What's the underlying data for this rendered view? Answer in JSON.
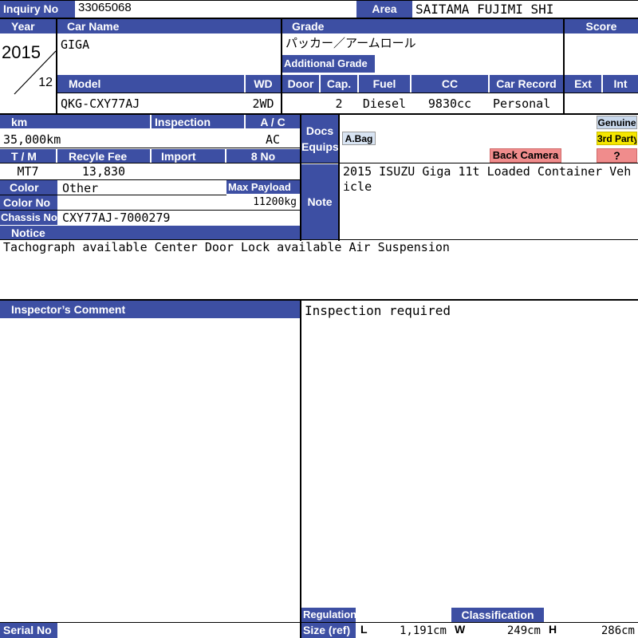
{
  "header": {
    "inquiry_label": "Inquiry No",
    "inquiry_value": "33065068",
    "area_label": "Area",
    "area_value": "SAITAMA FUJIMI SHI"
  },
  "car": {
    "year_label": "Year",
    "year_value": "2015",
    "month_value": "12",
    "name_label": "Car Name",
    "name_value": "GIGA",
    "grade_label": "Grade",
    "grade_value": "パッカー／アームロール",
    "additional_grade_label": "Additional Grade",
    "additional_grade_value": "",
    "score_label": "Score",
    "score_value": ""
  },
  "specs": {
    "model_label": "Model",
    "model_value": "QKG-CXY77AJ",
    "wd_label": "WD",
    "wd_value": "2WD",
    "door_label": "Door",
    "door_value": "",
    "cap_label": "Cap.",
    "cap_value": "2",
    "fuel_label": "Fuel",
    "fuel_value": "Diesel",
    "cc_label": "CC",
    "cc_value": "9830cc",
    "record_label": "Car Record",
    "record_value": "Personal",
    "ext_label": "Ext",
    "ext_value": "",
    "int_label": "Int",
    "int_value": ""
  },
  "details": {
    "km_label": "km",
    "km_value": "35,000km",
    "inspection_label": "Inspection",
    "inspection_value": "",
    "ac_label": "A / C",
    "ac_value": "AC",
    "tm_label": "T / M",
    "tm_value": "MT7",
    "recycle_label": "Recyle Fee",
    "recycle_value": "13,830",
    "import_label": "Import",
    "import_value": "",
    "eight_no_label": "8 No",
    "eight_no_value": "",
    "color_label": "Color",
    "color_value": "Other",
    "max_payload_label": "Max Payload",
    "max_payload_value": "11200kg",
    "color_no_label": "Color No",
    "color_no_value": "",
    "chassis_label": "Chassis No",
    "chassis_value": "CXY77AJ-7000279",
    "notice_label": "Notice",
    "notice_value": "Tachograph available Center Door Lock available Air Suspension"
  },
  "equips": {
    "label_line1": "Docs",
    "label_line2": "Equips",
    "abag": "A.Bag",
    "back_camera": "Back Camera",
    "genuine": "Genuine",
    "third_party": "3rd Party",
    "unknown": "?"
  },
  "note": {
    "label": "Note",
    "value": "2015 ISUZU Giga 11t Loaded Container Vehicle"
  },
  "inspector": {
    "label": "Inspector’s Comment",
    "value": "Inspection required"
  },
  "footer": {
    "serial_label": "Serial No",
    "serial_value": "",
    "regulation_label": "Regulation",
    "size_label": "Size (ref)",
    "classification_label": "Classification",
    "classification_value": "",
    "l_label": "L",
    "l_value": "1,191cm",
    "w_label": "W",
    "w_value": "249cm",
    "h_label": "H",
    "h_value": "286cm"
  },
  "colors": {
    "header_bg": "#3d4fa3",
    "abag_bg": "#d8e4f3",
    "back_camera_bg": "#f08c8c",
    "genuine_bg": "#c8d8ec",
    "third_party_bg": "#f5e600",
    "unknown_bg": "#f08c8c"
  }
}
